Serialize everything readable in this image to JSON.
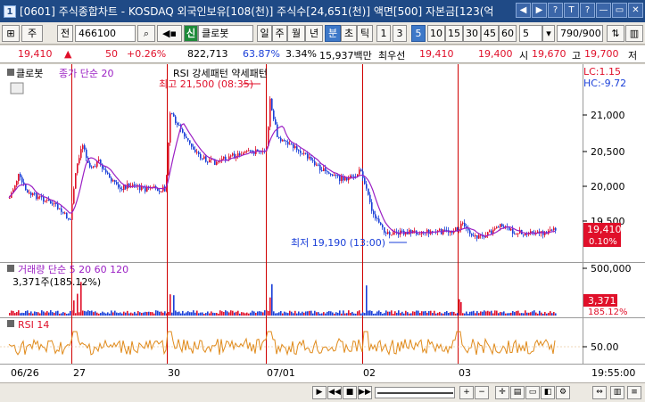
{
  "window": {
    "title": "[0601] 주식종합차트 - KOSDAQ 외국인보유[108(천)] 주식수[24,651(천)] 액면[500] 자본금[123(억",
    "badge": "1",
    "buttons": [
      "◀",
      "▶",
      "?",
      "T",
      "?",
      "—",
      "▭",
      "✕"
    ]
  },
  "toolbar": {
    "grid_icon": "⊞",
    "market": "주",
    "all_label": "전",
    "code": "466100",
    "new_label": "신",
    "stock_name": "클로봇",
    "periods": [
      "일",
      "주",
      "월",
      "년",
      "분",
      "초",
      "틱"
    ],
    "period_selected": "분",
    "intervals": [
      "1",
      "3",
      "5",
      "10",
      "15",
      "30",
      "45",
      "60"
    ],
    "interval_selected": "5",
    "interval_input": "5",
    "count": "790/900"
  },
  "quote": {
    "price": "19,410",
    "direction": "▲",
    "change": "50",
    "change_pct": "+0.26%",
    "volume": "822,713",
    "ratio1": "63.87%",
    "ratio2": "3.34%",
    "amount": "15,937백만",
    "priority_label": "최우선",
    "bid1": "19,410",
    "bid2": "19,400",
    "high_label": "시",
    "high_val": "19,670",
    "low_label": "고",
    "low_val": "19,700",
    "next_label": "저"
  },
  "chart": {
    "top_legend": {
      "name": "클로봇",
      "ma": "종가 단순 20",
      "pattern": "RSI 강세패턴 약세패턴"
    },
    "price_axis": [
      "21,000",
      "20,500",
      "20,000",
      "19,500"
    ],
    "current_price": "19,410",
    "current_pct": "0.10%",
    "lc": "LC:1.15",
    "hc": "HC:-9.72",
    "max_note": "최고 21,500 (08:35)",
    "min_note": "최저 19,190 (13:00)",
    "volume_legend": "거래량 단순 5 20 60 120",
    "volume_ma_labels": [
      "5",
      "20",
      "60",
      "120"
    ],
    "volume_value": "3,371주(185.12%)",
    "volume_axis": [
      "500,000",
      "0"
    ],
    "volume_current": "3,371",
    "volume_pct": "185.12%",
    "rsi_legend": "RSI 14",
    "rsi_axis": "50.00",
    "dates": [
      "06/26",
      "27",
      "30",
      "07/01",
      "02",
      "03"
    ],
    "time_label": "19:55:00"
  },
  "colors": {
    "up": "#e0102a",
    "down": "#1a3fd8",
    "ma": "#9b1fc4",
    "rsi": "#e08a1a",
    "divider": "#d00000"
  },
  "bottom": {
    "controls": [
      "▶",
      "◀◀",
      "■",
      "▶▶",
      "+",
      "−"
    ]
  }
}
